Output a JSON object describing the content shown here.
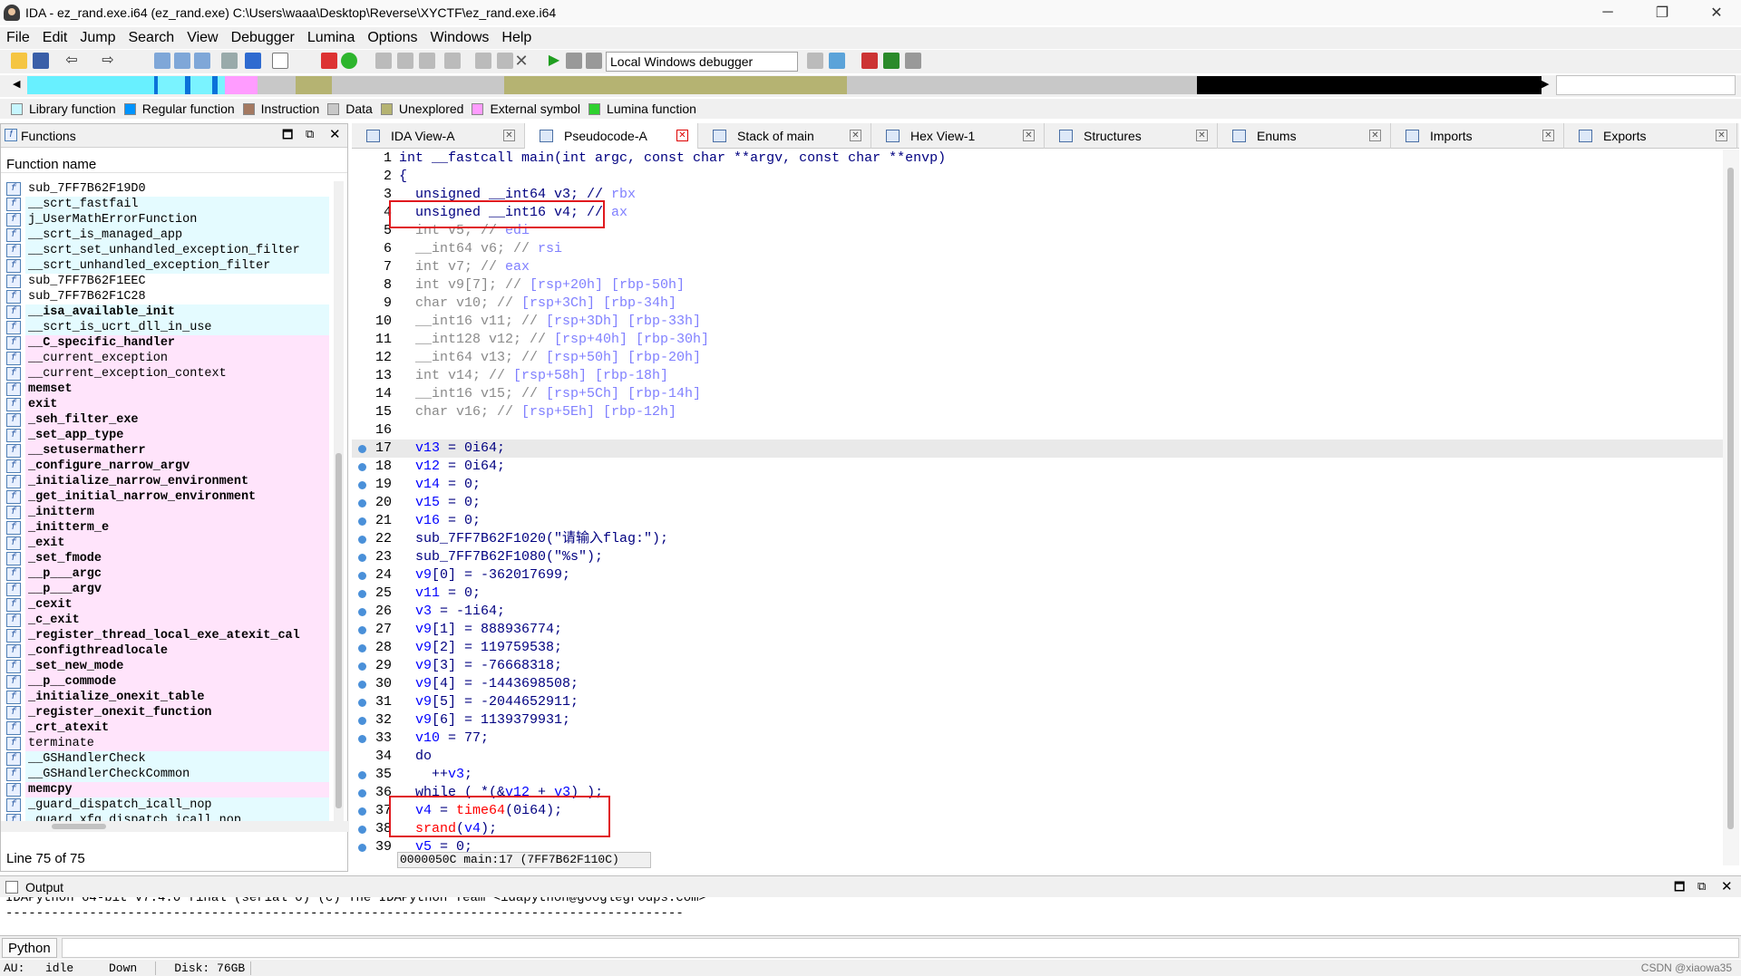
{
  "window": {
    "title": "IDA - ez_rand.exe.i64 (ez_rand.exe) C:\\Users\\waaa\\Desktop\\Reverse\\XYCTF\\ez_rand.exe.i64",
    "minimize": "─",
    "maximize": "❐",
    "close": "✕"
  },
  "menu": [
    "File",
    "Edit",
    "Jump",
    "Search",
    "View",
    "Debugger",
    "Lumina",
    "Options",
    "Windows",
    "Help"
  ],
  "toolbar": {
    "debugger": "Local Windows debugger"
  },
  "legend": [
    {
      "label": "Library function",
      "color": "#c6f6ff"
    },
    {
      "label": "Regular function",
      "color": "#0094ff"
    },
    {
      "label": "Instruction",
      "color": "#a47961"
    },
    {
      "label": "Data",
      "color": "#c8c8c8"
    },
    {
      "label": "Unexplored",
      "color": "#b5b372"
    },
    {
      "label": "External symbol",
      "color": "#ff9cff"
    },
    {
      "label": "Lumina function",
      "color": "#2ed12e"
    }
  ],
  "functions": {
    "title": "Functions",
    "column": "Function name",
    "status": "Line 75 of 75",
    "items": [
      {
        "name": "sub_7FF7B62F19D0",
        "kind": "reg"
      },
      {
        "name": "__scrt_fastfail",
        "kind": "lib"
      },
      {
        "name": "j_UserMathErrorFunction",
        "kind": "lib"
      },
      {
        "name": "__scrt_is_managed_app",
        "kind": "lib"
      },
      {
        "name": "__scrt_set_unhandled_exception_filter",
        "kind": "lib"
      },
      {
        "name": "__scrt_unhandled_exception_filter",
        "kind": "lib"
      },
      {
        "name": "sub_7FF7B62F1EEC",
        "kind": "reg"
      },
      {
        "name": "sub_7FF7B62F1C28",
        "kind": "reg"
      },
      {
        "name": "__isa_available_init",
        "kind": "lib",
        "bold": true
      },
      {
        "name": "__scrt_is_ucrt_dll_in_use",
        "kind": "lib"
      },
      {
        "name": "__C_specific_handler",
        "kind": "ext",
        "bold": true
      },
      {
        "name": "__current_exception",
        "kind": "ext"
      },
      {
        "name": "__current_exception_context",
        "kind": "ext"
      },
      {
        "name": "memset",
        "kind": "ext",
        "bold": true
      },
      {
        "name": "exit",
        "kind": "ext",
        "bold": true
      },
      {
        "name": "_seh_filter_exe",
        "kind": "ext",
        "bold": true
      },
      {
        "name": "_set_app_type",
        "kind": "ext",
        "bold": true
      },
      {
        "name": "__setusermatherr",
        "kind": "ext",
        "bold": true
      },
      {
        "name": "_configure_narrow_argv",
        "kind": "ext",
        "bold": true
      },
      {
        "name": "_initialize_narrow_environment",
        "kind": "ext",
        "bold": true
      },
      {
        "name": "_get_initial_narrow_environment",
        "kind": "ext",
        "bold": true
      },
      {
        "name": "_initterm",
        "kind": "ext",
        "bold": true
      },
      {
        "name": "_initterm_e",
        "kind": "ext",
        "bold": true
      },
      {
        "name": "_exit",
        "kind": "ext",
        "bold": true
      },
      {
        "name": "_set_fmode",
        "kind": "ext",
        "bold": true
      },
      {
        "name": "__p___argc",
        "kind": "ext",
        "bold": true
      },
      {
        "name": "__p___argv",
        "kind": "ext",
        "bold": true
      },
      {
        "name": "_cexit",
        "kind": "ext",
        "bold": true
      },
      {
        "name": "_c_exit",
        "kind": "ext",
        "bold": true
      },
      {
        "name": "_register_thread_local_exe_atexit_cal",
        "kind": "ext",
        "bold": true
      },
      {
        "name": "_configthreadlocale",
        "kind": "ext",
        "bold": true
      },
      {
        "name": "_set_new_mode",
        "kind": "ext",
        "bold": true
      },
      {
        "name": "__p__commode",
        "kind": "ext",
        "bold": true
      },
      {
        "name": "_initialize_onexit_table",
        "kind": "ext",
        "bold": true
      },
      {
        "name": "_register_onexit_function",
        "kind": "ext",
        "bold": true
      },
      {
        "name": "_crt_atexit",
        "kind": "ext",
        "bold": true
      },
      {
        "name": "terminate",
        "kind": "ext"
      },
      {
        "name": "__GSHandlerCheck",
        "kind": "lib"
      },
      {
        "name": "__GSHandlerCheckCommon",
        "kind": "lib"
      },
      {
        "name": "memcpy",
        "kind": "ext",
        "bold": true
      },
      {
        "name": "_guard_dispatch_icall_nop",
        "kind": "lib"
      },
      {
        "name": "_guard_xfg_dispatch_icall_nop",
        "kind": "lib"
      }
    ]
  },
  "tabs": [
    {
      "label": "IDA View-A",
      "active": false
    },
    {
      "label": "Pseudocode-A",
      "active": true
    },
    {
      "label": "Stack of main",
      "active": false
    },
    {
      "label": "Hex View-1",
      "active": false
    },
    {
      "label": "Structures",
      "active": false
    },
    {
      "label": "Enums",
      "active": false
    },
    {
      "label": "Imports",
      "active": false
    },
    {
      "label": "Exports",
      "active": false
    }
  ],
  "code": [
    {
      "n": "1",
      "bp": false,
      "t": [
        [
          "int __fastcall main(int argc, const char **argv, const char **envp)",
          "k"
        ]
      ]
    },
    {
      "n": "2",
      "bp": false,
      "t": [
        [
          "{",
          "k"
        ]
      ]
    },
    {
      "n": "3",
      "bp": false,
      "t": [
        [
          "  unsigned __int64 v3; // ",
          "k"
        ],
        [
          "rbx",
          "cm"
        ]
      ]
    },
    {
      "n": "4",
      "bp": false,
      "t": [
        [
          "  unsigned __int16 v4; // ",
          "k"
        ],
        [
          "ax",
          "cm"
        ]
      ]
    },
    {
      "n": "5",
      "bp": false,
      "t": [
        [
          "  int v5; // ",
          "g"
        ],
        [
          "edi",
          "cm"
        ]
      ]
    },
    {
      "n": "6",
      "bp": false,
      "t": [
        [
          "  __int64 v6; // ",
          "g"
        ],
        [
          "rsi",
          "cm"
        ]
      ]
    },
    {
      "n": "7",
      "bp": false,
      "t": [
        [
          "  int v7; // ",
          "g"
        ],
        [
          "eax",
          "cm"
        ]
      ]
    },
    {
      "n": "8",
      "bp": false,
      "t": [
        [
          "  int v9[7]; // ",
          "g"
        ],
        [
          "[rsp+20h] [rbp-50h]",
          "cm"
        ]
      ]
    },
    {
      "n": "9",
      "bp": false,
      "t": [
        [
          "  char v10; // ",
          "g"
        ],
        [
          "[rsp+3Ch] [rbp-34h]",
          "cm"
        ]
      ]
    },
    {
      "n": "10",
      "bp": false,
      "t": [
        [
          "  __int16 v11; // ",
          "g"
        ],
        [
          "[rsp+3Dh] [rbp-33h]",
          "cm"
        ]
      ]
    },
    {
      "n": "11",
      "bp": false,
      "t": [
        [
          "  __int128 v12; // ",
          "g"
        ],
        [
          "[rsp+40h] [rbp-30h]",
          "cm"
        ]
      ]
    },
    {
      "n": "12",
      "bp": false,
      "t": [
        [
          "  __int64 v13; // ",
          "g"
        ],
        [
          "[rsp+50h] [rbp-20h]",
          "cm"
        ]
      ]
    },
    {
      "n": "13",
      "bp": false,
      "t": [
        [
          "  int v14; // ",
          "g"
        ],
        [
          "[rsp+58h] [rbp-18h]",
          "cm"
        ]
      ]
    },
    {
      "n": "14",
      "bp": false,
      "t": [
        [
          "  __int16 v15; // ",
          "g"
        ],
        [
          "[rsp+5Ch] [rbp-14h]",
          "cm"
        ]
      ]
    },
    {
      "n": "15",
      "bp": false,
      "t": [
        [
          "  char v16; // ",
          "g"
        ],
        [
          "[rsp+5Eh] [rbp-12h]",
          "cm"
        ]
      ]
    },
    {
      "n": "16",
      "bp": false,
      "t": []
    },
    {
      "n": "17",
      "bp": true,
      "hl": true,
      "t": [
        [
          "  ",
          "k"
        ],
        [
          "v13",
          "v"
        ],
        [
          " = 0i64;",
          "k"
        ]
      ]
    },
    {
      "n": "18",
      "bp": true,
      "t": [
        [
          "  ",
          "k"
        ],
        [
          "v12",
          "v"
        ],
        [
          " = 0i64;",
          "k"
        ]
      ]
    },
    {
      "n": "19",
      "bp": true,
      "t": [
        [
          "  ",
          "k"
        ],
        [
          "v14",
          "v"
        ],
        [
          " = 0;",
          "k"
        ]
      ]
    },
    {
      "n": "20",
      "bp": true,
      "t": [
        [
          "  ",
          "k"
        ],
        [
          "v15",
          "v"
        ],
        [
          " = 0;",
          "k"
        ]
      ]
    },
    {
      "n": "21",
      "bp": true,
      "t": [
        [
          "  ",
          "k"
        ],
        [
          "v16",
          "v"
        ],
        [
          " = 0;",
          "k"
        ]
      ]
    },
    {
      "n": "22",
      "bp": true,
      "t": [
        [
          "  sub_7FF7B62F1020(\"请输入flag:\");",
          "k"
        ]
      ]
    },
    {
      "n": "23",
      "bp": true,
      "t": [
        [
          "  sub_7FF7B62F1080(\"%s\");",
          "k"
        ]
      ]
    },
    {
      "n": "24",
      "bp": true,
      "t": [
        [
          "  ",
          "k"
        ],
        [
          "v9",
          "v"
        ],
        [
          "[0] = -362017699;",
          "k"
        ]
      ]
    },
    {
      "n": "25",
      "bp": true,
      "t": [
        [
          "  ",
          "k"
        ],
        [
          "v11",
          "v"
        ],
        [
          " = 0;",
          "k"
        ]
      ]
    },
    {
      "n": "26",
      "bp": true,
      "t": [
        [
          "  ",
          "k"
        ],
        [
          "v3",
          "v"
        ],
        [
          " = -1i64;",
          "k"
        ]
      ]
    },
    {
      "n": "27",
      "bp": true,
      "t": [
        [
          "  ",
          "k"
        ],
        [
          "v9",
          "v"
        ],
        [
          "[1] = 888936774;",
          "k"
        ]
      ]
    },
    {
      "n": "28",
      "bp": true,
      "t": [
        [
          "  ",
          "k"
        ],
        [
          "v9",
          "v"
        ],
        [
          "[2] = 119759538;",
          "k"
        ]
      ]
    },
    {
      "n": "29",
      "bp": true,
      "t": [
        [
          "  ",
          "k"
        ],
        [
          "v9",
          "v"
        ],
        [
          "[3] = -76668318;",
          "k"
        ]
      ]
    },
    {
      "n": "30",
      "bp": true,
      "t": [
        [
          "  ",
          "k"
        ],
        [
          "v9",
          "v"
        ],
        [
          "[4] = -1443698508;",
          "k"
        ]
      ]
    },
    {
      "n": "31",
      "bp": true,
      "t": [
        [
          "  ",
          "k"
        ],
        [
          "v9",
          "v"
        ],
        [
          "[5] = -2044652911;",
          "k"
        ]
      ]
    },
    {
      "n": "32",
      "bp": true,
      "t": [
        [
          "  ",
          "k"
        ],
        [
          "v9",
          "v"
        ],
        [
          "[6] = 1139379931;",
          "k"
        ]
      ]
    },
    {
      "n": "33",
      "bp": true,
      "t": [
        [
          "  ",
          "k"
        ],
        [
          "v10",
          "v"
        ],
        [
          " = 77;",
          "k"
        ]
      ]
    },
    {
      "n": "34",
      "bp": false,
      "t": [
        [
          "  do",
          "k"
        ]
      ]
    },
    {
      "n": "35",
      "bp": true,
      "t": [
        [
          "    ++",
          "k"
        ],
        [
          "v3",
          "v"
        ],
        [
          ";",
          "k"
        ]
      ]
    },
    {
      "n": "36",
      "bp": true,
      "t": [
        [
          "  while ( *(&",
          "k"
        ],
        [
          "v12",
          "v"
        ],
        [
          " + ",
          "k"
        ],
        [
          "v3",
          "v"
        ],
        [
          ") );",
          "k"
        ]
      ]
    },
    {
      "n": "37",
      "bp": true,
      "t": [
        [
          "  ",
          "k"
        ],
        [
          "v4",
          "v"
        ],
        [
          " = ",
          "k"
        ],
        [
          "time64",
          "red"
        ],
        [
          "(0i64);",
          "k"
        ]
      ]
    },
    {
      "n": "38",
      "bp": true,
      "t": [
        [
          "  ",
          "k"
        ],
        [
          "srand",
          "red"
        ],
        [
          "(",
          "k"
        ],
        [
          "v4",
          "v"
        ],
        [
          ");",
          "k"
        ]
      ]
    },
    {
      "n": "39",
      "bp": true,
      "t": [
        [
          "  ",
          "k"
        ],
        [
          "v5",
          "v"
        ],
        [
          " = 0;",
          "k"
        ]
      ]
    }
  ],
  "code_status": "0000050C main:17 (7FF7B62F110C)",
  "output": {
    "title": "Output",
    "line1": "IDAPython 64-bit v7.4.0 final (serial 0) (c) The IDAPython Team <idapython@googlegroups.com>",
    "line2": "-----------------------------------------------------------------------------------------",
    "input_label": "Python"
  },
  "status": {
    "au": "AU:",
    "state": "idle",
    "dir": "Down",
    "disk": "Disk: 76GB"
  },
  "watermark": "CSDN @xiaowa35"
}
